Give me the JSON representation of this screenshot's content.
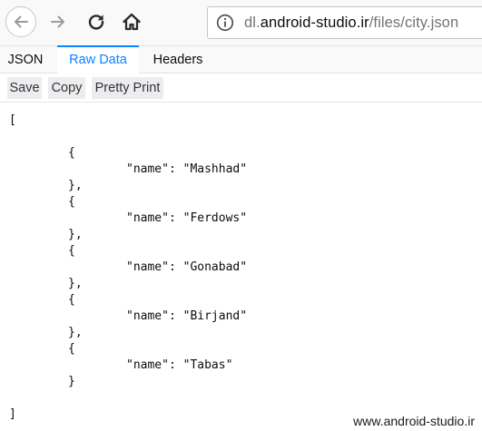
{
  "browser": {
    "url": {
      "prefix": "dl.",
      "host": "android-studio.ir",
      "path": "/files/city.json"
    },
    "icons": {
      "back": "back-arrow-icon",
      "forward": "forward-arrow-icon",
      "reload": "reload-icon",
      "home": "home-icon",
      "site_info": "info-icon"
    }
  },
  "viewer": {
    "tabs": [
      {
        "label": "JSON"
      },
      {
        "label": "Raw Data",
        "active": true
      },
      {
        "label": "Headers"
      }
    ],
    "actions": {
      "save": "Save",
      "copy": "Copy",
      "pretty_print": "Pretty Print"
    },
    "accent_color": "#0a84ff"
  },
  "raw_json": {
    "open_bracket": "[",
    "close_bracket": "]",
    "items": [
      {
        "open": "{",
        "key_value": "\"name\": \"Mashhad\"",
        "close": "},"
      },
      {
        "open": "{",
        "key_value": "\"name\": \"Ferdows\"",
        "close": "},"
      },
      {
        "open": "{",
        "key_value": "\"name\": \"Gonabad\"",
        "close": "},"
      },
      {
        "open": "{",
        "key_value": "\"name\": \"Birjand\"",
        "close": "},"
      },
      {
        "open": "{",
        "key_value": "\"name\": \"Tabas\"",
        "close": "}"
      }
    ]
  },
  "watermark": "www.android-studio.ir"
}
